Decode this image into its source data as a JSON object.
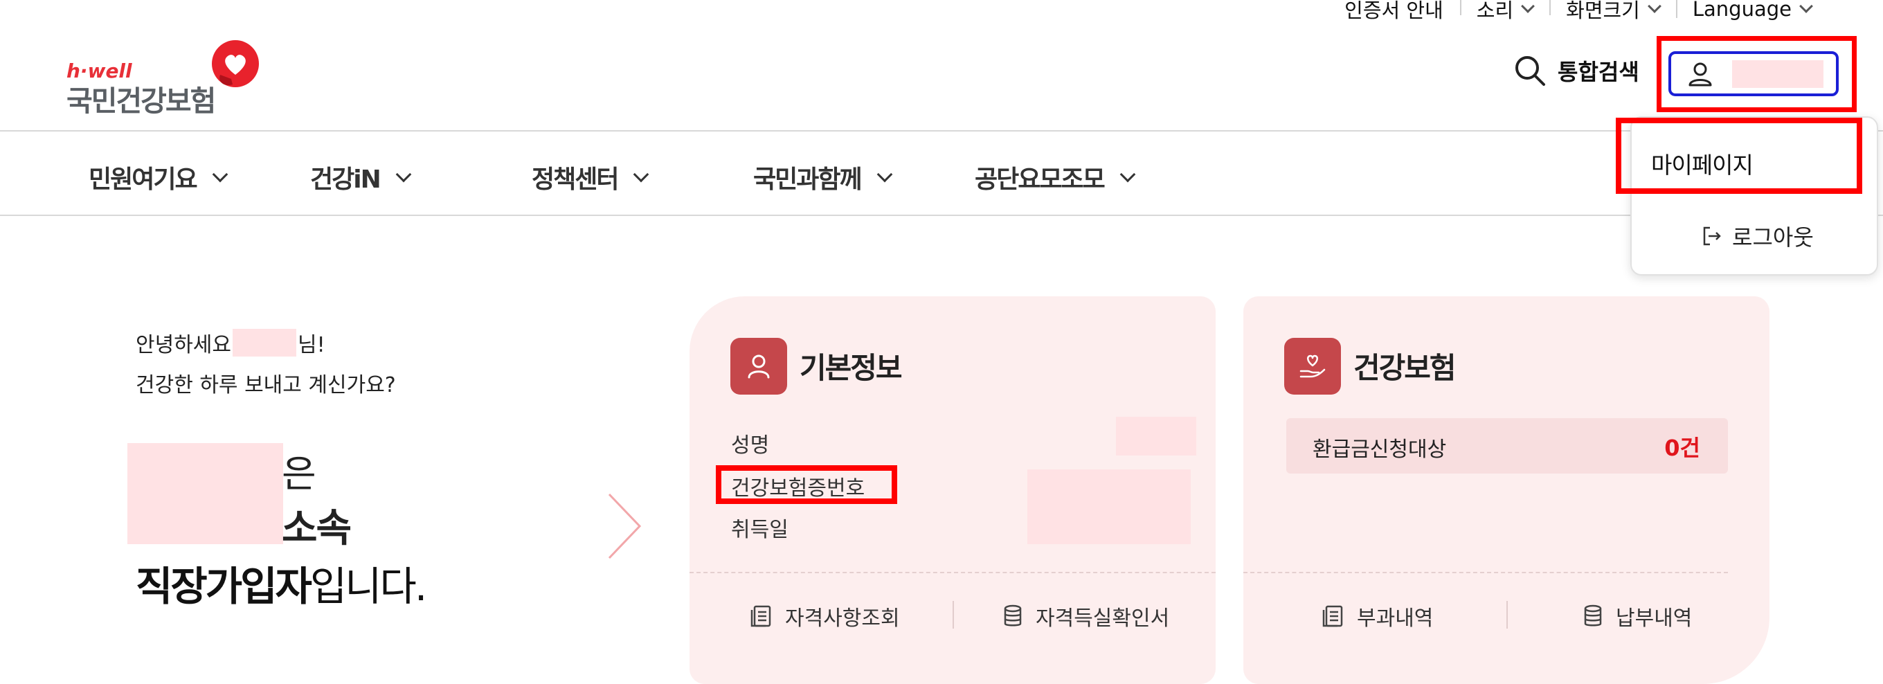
{
  "utility": {
    "items": [
      {
        "label": "인증서 안내",
        "has_chevron": false
      },
      {
        "label": "소리",
        "has_chevron": true
      },
      {
        "label": "화면크기",
        "has_chevron": true
      },
      {
        "label": "Language",
        "has_chevron": true
      }
    ]
  },
  "logo": {
    "tagline": "h·well",
    "name": "국민건강보험"
  },
  "header": {
    "search_label": "통합검색",
    "user_icon": "user-icon"
  },
  "nav": {
    "items": [
      {
        "label": "민원여기요"
      },
      {
        "label": "건강iN"
      },
      {
        "label": "정책센터"
      },
      {
        "label": "국민과함께"
      },
      {
        "label": "공단요모조모"
      }
    ]
  },
  "user_menu": {
    "mypage": "마이페이지",
    "logout": "로그아웃"
  },
  "greeting": {
    "hello_prefix": "안녕하세요",
    "hello_suffix": "님!",
    "line2": "건강한 하루 보내고 계신가요?",
    "org_particle": "은",
    "org_suffix": "소속",
    "member_bold": "직장가입자",
    "member_rest": "입니다."
  },
  "basic_info_card": {
    "title": "기본정보",
    "fields": [
      {
        "label": "성명"
      },
      {
        "label": "건강보험증번호"
      },
      {
        "label": "취득일"
      }
    ],
    "links": [
      {
        "label": "자격사항조회",
        "icon": "document-list-icon"
      },
      {
        "label": "자격득실확인서",
        "icon": "database-icon"
      }
    ]
  },
  "insurance_card": {
    "title": "건강보험",
    "refund_label": "환급금신청대상",
    "refund_count": "0건",
    "links": [
      {
        "label": "부과내역",
        "icon": "document-list-icon"
      },
      {
        "label": "납부내역",
        "icon": "database-icon"
      }
    ]
  },
  "colors": {
    "brand_red": "#e83038",
    "card_bg": "#fdeeee",
    "icon_bg": "#c5474b",
    "annotation_red": "#ff0000",
    "focus_blue": "#1a1fd6",
    "count_red": "#e0151c"
  }
}
